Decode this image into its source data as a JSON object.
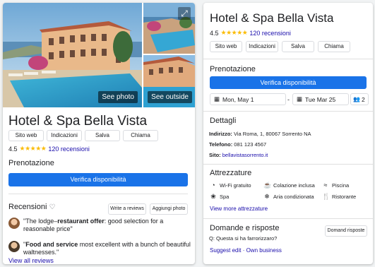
{
  "gallery": {
    "see_photos": "See photo",
    "see_outside": "See outside"
  },
  "hotel": {
    "name": "Hotel & Spa Bella Vista",
    "rating": "4.5",
    "stars": "★★★★★",
    "reviews": "120 recensioni"
  },
  "actions": {
    "website": "Sito web",
    "directions": "Indicazioni",
    "save": "Salva",
    "call": "Chiama"
  },
  "booking": {
    "title": "Prenotazione",
    "check_button": "Verifica disponibilità",
    "checkin": "Mon, May 1",
    "dash": "-",
    "checkout": "Tue Mar 25",
    "guests": "2"
  },
  "reviews_section": {
    "title": "Recensioni",
    "write_review": "Write a reviews",
    "add_photo": "Aggiungi photo",
    "view_all": "View all reviews",
    "items": [
      {
        "pre": "\"The lodge–",
        "bold": "restaurant offer",
        "post": ": good selection for a reasonable price\""
      },
      {
        "pre": "\"",
        "bold": "Food and service",
        "post": " most excellent with a bunch of beautiful waltnesses.\""
      }
    ]
  },
  "details": {
    "title": "Dettagli",
    "address_label": "Indirizzo:",
    "address": "Via Roma, 1, 80067 Sorrento NA",
    "phone_label": "Telefono:",
    "phone": "081 123 4567",
    "site_label": "Sito:",
    "site": "bellavistasorrento.it"
  },
  "amenities": {
    "title": "Attrezzature",
    "items": [
      "Wi-Fi gratuito",
      "Colazione inclusa",
      "Piscina",
      "Spa",
      "Aria condizionata",
      "Ristorante"
    ],
    "view_more": "View more attrezzature"
  },
  "qa": {
    "title": "Domande e risposte",
    "button": "Domand risposte",
    "question": "Q: Questa si ha farrorizzaro?",
    "suggest": "Suggest edit · Own business"
  },
  "colors": {
    "accent": "#1a73e8",
    "link": "#1a0dab",
    "star": "#fbbc04"
  }
}
